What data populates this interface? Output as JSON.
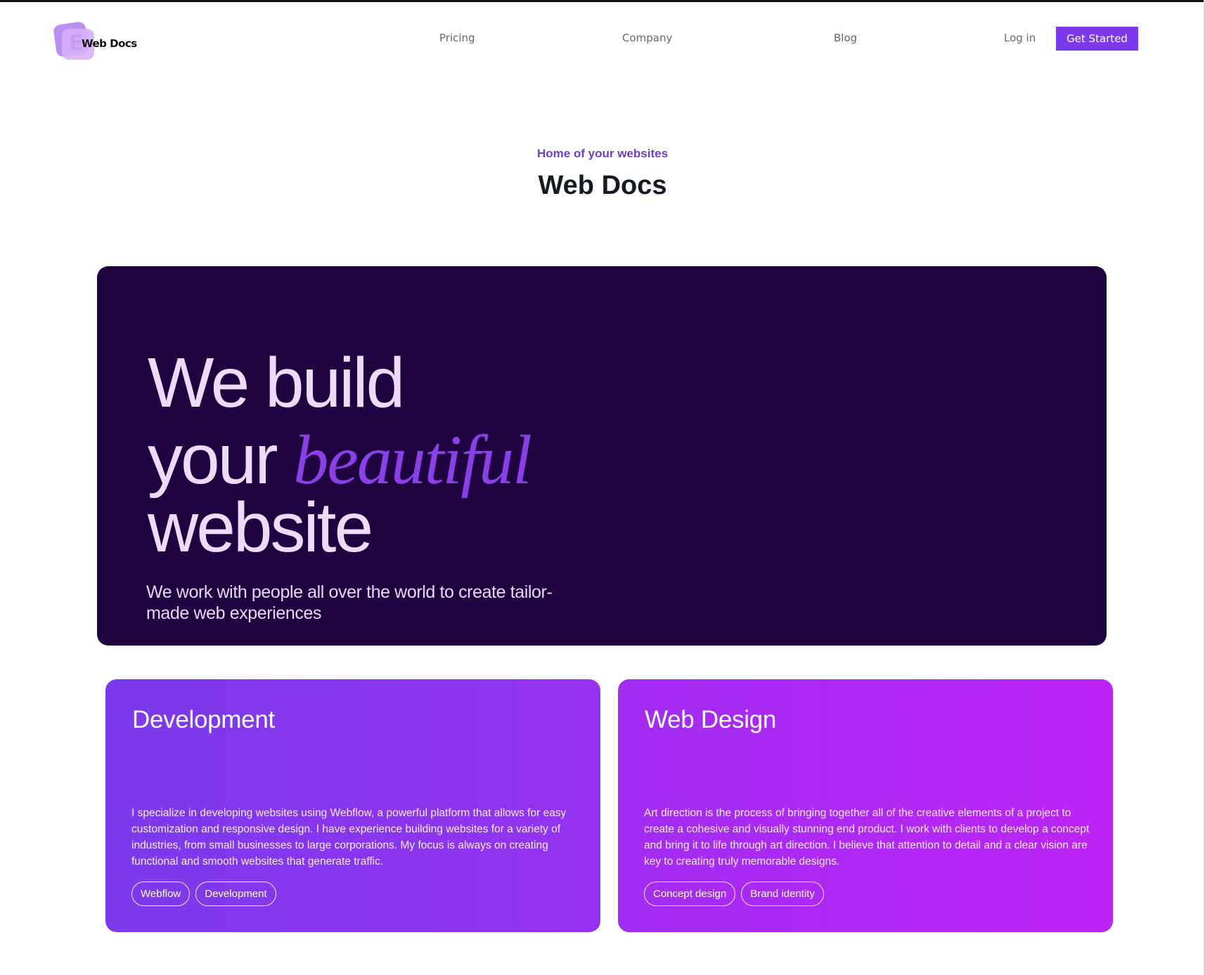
{
  "header": {
    "logo_text": "Web Docs",
    "nav": {
      "pricing": "Pricing",
      "company": "Company",
      "blog": "Blog",
      "login": "Log in"
    },
    "cta": "Get Started"
  },
  "intro": {
    "eyebrow": "Home of your websites",
    "title": "Web Docs"
  },
  "hero": {
    "line1": "We build",
    "line2_plain": "your",
    "line2_accent": "beautiful",
    "line3": "website",
    "subtitle": "We work with people all over the world to create tailor-made web experiences"
  },
  "cards": [
    {
      "title": "Development",
      "description": "I specialize in developing websites using Webflow, a powerful platform that allows for easy customization and responsive design. I have experience building websites for a variety of industries, from small businesses to large corporations. My focus is always on creating functional and smooth websites that generate traffic.",
      "tags": [
        "Webflow",
        "Development"
      ]
    },
    {
      "title": "Web Design",
      "description": "Art direction is the process of bringing together all of the creative elements of a project to create a cohesive and visually stunning end product. I work with clients to develop a concept and bring it to life through art direction. I believe that attention to detail and a clear vision are key to creating truly memorable designs.",
      "tags": [
        "Concept design",
        "Brand identity"
      ]
    }
  ],
  "colors": {
    "accent": "#7c3aed",
    "hero_bg": "#1e0340",
    "hero_accent_text": "#8b3fe6",
    "card_dev": "#8535ee",
    "card_web": "#b027f4"
  }
}
